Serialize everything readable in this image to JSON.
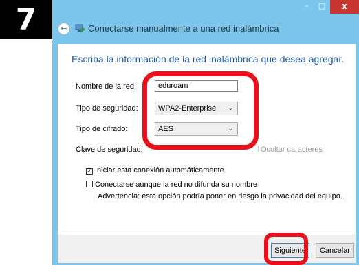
{
  "step_number": "7",
  "window": {
    "title": "Conectarse manualmente a una red inalámbrica",
    "controls": {
      "minimize": "–",
      "maximize": "□",
      "close": "x"
    }
  },
  "heading": "Escriba la información de la red inalámbrica que desea agregar.",
  "form": {
    "network_name_label": "Nombre de la red:",
    "network_name_value": "eduroam",
    "security_type_label": "Tipo de seguridad:",
    "security_type_value": "WPA2-Enterprise",
    "encryption_type_label": "Tipo de cifrado:",
    "encryption_type_value": "AES",
    "security_key_label": "Clave de seguridad:",
    "hide_chars_label": "Ocultar caracteres"
  },
  "options": {
    "auto_connect_label": "Iniciar esta conexión automáticamente",
    "auto_connect_checked": true,
    "connect_hidden_label": "Conectarse aunque la red no difunda su nombre",
    "connect_hidden_checked": false,
    "warning": "Advertencia: esta opción podría poner en riesgo la privacidad del equipo."
  },
  "buttons": {
    "next": "Siguiente",
    "cancel": "Cancelar"
  },
  "colors": {
    "highlight": "#e8101a",
    "title_bar": "#7bc6ea",
    "heading": "#1e5aa8",
    "close_button": "#c7372f"
  }
}
